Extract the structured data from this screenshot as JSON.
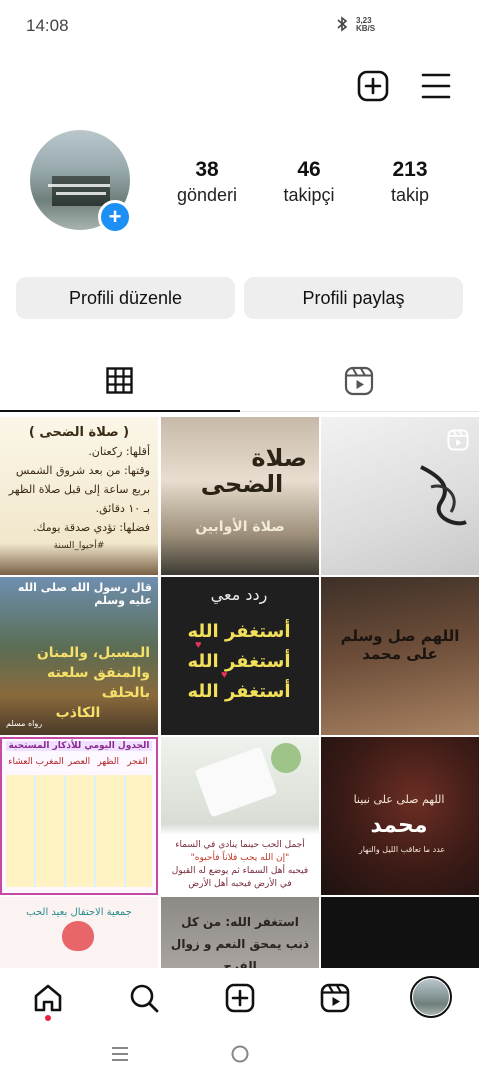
{
  "status_bar": {
    "time": "14:08",
    "network_speed_value": "3,23",
    "network_speed_unit": "KB/S"
  },
  "header": {
    "create_icon": "plus-square-icon",
    "menu_icon": "hamburger-menu-icon"
  },
  "profile": {
    "add_story_badge": "+",
    "stats": [
      {
        "count": "38",
        "label": "gönderi"
      },
      {
        "count": "46",
        "label": "takipçi"
      },
      {
        "count": "213",
        "label": "takip"
      }
    ],
    "edit_button": "Profili düzenle",
    "share_button": "Profili paylaş"
  },
  "tabs": {
    "posts_icon": "grid-icon",
    "reels_icon": "reels-icon",
    "active": "posts"
  },
  "grid": {
    "posts": [
      {
        "lines": [
          "( صلاة الضحى )",
          "أقلها: ركعتان.",
          "وقتها: من بعد شروق الشمس",
          "بربع ساعة إلى قبل صلاة الظهر",
          "بـ ١٠ دقائق.",
          "فضلها: تؤدي صدقة يومك.",
          "#أحيوا_السنة"
        ]
      },
      {
        "lines": [
          "صلاة",
          "الضحى",
          "صلاة الأوابين"
        ]
      },
      {
        "lines": []
      },
      {
        "lines": [
          "قال رسول الله صلى الله عليه وسلم",
          "المسبل، والمنان",
          "والمنفق سلعته بالحلف",
          "الكاذب",
          "رواه مسلم"
        ]
      },
      {
        "lines": [
          "ردد معي",
          "أستغفر الله",
          "أستغفر الله",
          "أستغفر الله"
        ]
      },
      {
        "lines": [
          "اللهم صل وسلم على محمد"
        ]
      },
      {
        "lines": [
          "الجدول اليومي للأذكار المستحبة",
          "الفجر",
          "الظهر",
          "العصر",
          "المغرب",
          "العشاء"
        ]
      },
      {
        "lines": [
          "أجمل الحب حينما ينادي في السماء",
          "\"إن الله يحب فلاناً فأحبوه\"",
          "فيحبه أهل السماء ثم يوضع له القبول",
          "في الأرض فيحبه أهل الأرض"
        ]
      },
      {
        "lines": [
          "اللهم صلى على نبينا",
          "محمد",
          "عدد ما تعاقب الليل والنهار"
        ]
      },
      {
        "lines": [
          "جمعية الاحتفال بعيد الحب"
        ]
      },
      {
        "lines": [
          "استغفر الله: من كل",
          "ذنب يمحق النعم و زوال الفرح"
        ]
      },
      {
        "lines": []
      }
    ]
  },
  "bottom_nav": {
    "items": [
      "home-icon",
      "search-icon",
      "create-icon",
      "reels-icon",
      "profile-avatar"
    ]
  },
  "system_nav": {
    "items": [
      "recents-icon",
      "home-circle-icon"
    ]
  }
}
